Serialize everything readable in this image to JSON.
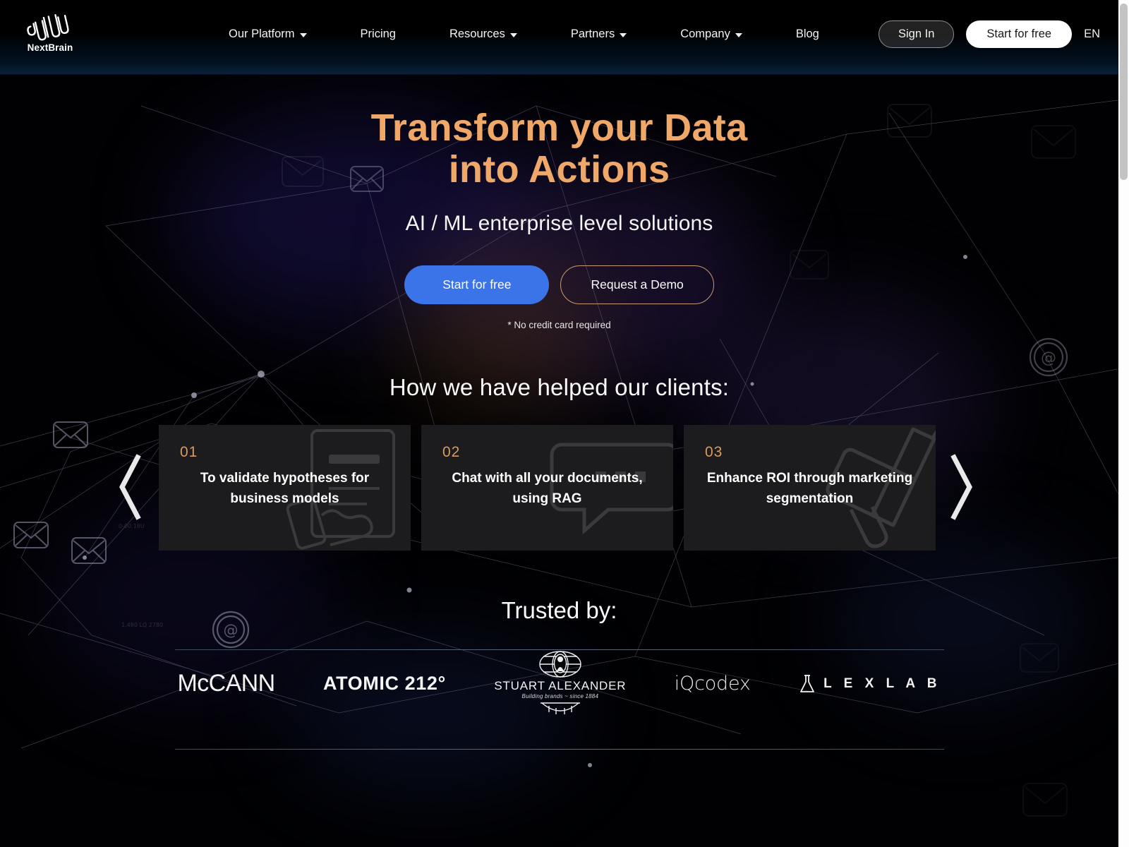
{
  "brand": {
    "name": "NextBrain",
    "logo_icon": "brainwave-squiggle-icon"
  },
  "nav": {
    "items": [
      {
        "label": "Our Platform",
        "has_dropdown": true
      },
      {
        "label": "Pricing",
        "has_dropdown": false
      },
      {
        "label": "Resources",
        "has_dropdown": true
      },
      {
        "label": "Partners",
        "has_dropdown": true
      },
      {
        "label": "Company",
        "has_dropdown": true
      },
      {
        "label": "Blog",
        "has_dropdown": false
      }
    ],
    "sign_in": "Sign In",
    "start_free": "Start for free",
    "language": "EN"
  },
  "hero": {
    "headline_line1": "Transform your Data",
    "headline_line2": "into Actions",
    "subheadline": "AI / ML enterprise level solutions",
    "primary_cta": "Start for free",
    "secondary_cta": "Request a Demo",
    "note": "* No credit card required",
    "headline_color": "#f0a868",
    "primary_cta_color": "#3b74e8",
    "secondary_cta_border": "#c89a6d"
  },
  "clients": {
    "title": "How we have helped our clients:",
    "prev_label": "Previous",
    "next_label": "Next",
    "cards": [
      {
        "number": "01",
        "text": "To validate hypotheses for business models",
        "watermark": "document-hand-icon"
      },
      {
        "number": "02",
        "text": "Chat with all your documents, using RAG",
        "watermark": "chat-bubble-icon"
      },
      {
        "number": "03",
        "text": "Enhance ROI through marketing segmentation",
        "watermark": "megaphone-icon"
      }
    ],
    "number_color": "#d99b5f",
    "card_bg": "#1c1c1e"
  },
  "trusted": {
    "title": "Trusted by:",
    "logos": [
      {
        "id": "mccann",
        "name": "McCANN"
      },
      {
        "id": "atomic212",
        "name": "ATOMIC 212°"
      },
      {
        "id": "stuart-alexander",
        "name": "STUART ALEXANDER",
        "tagline": "Building brands ~ since 1884"
      },
      {
        "id": "iqcodex",
        "name": "iQcodex"
      },
      {
        "id": "lexlab",
        "name": "L E X L A B",
        "icon": "flask-icon"
      }
    ]
  },
  "browser": {
    "scrollbar_visible": true
  }
}
